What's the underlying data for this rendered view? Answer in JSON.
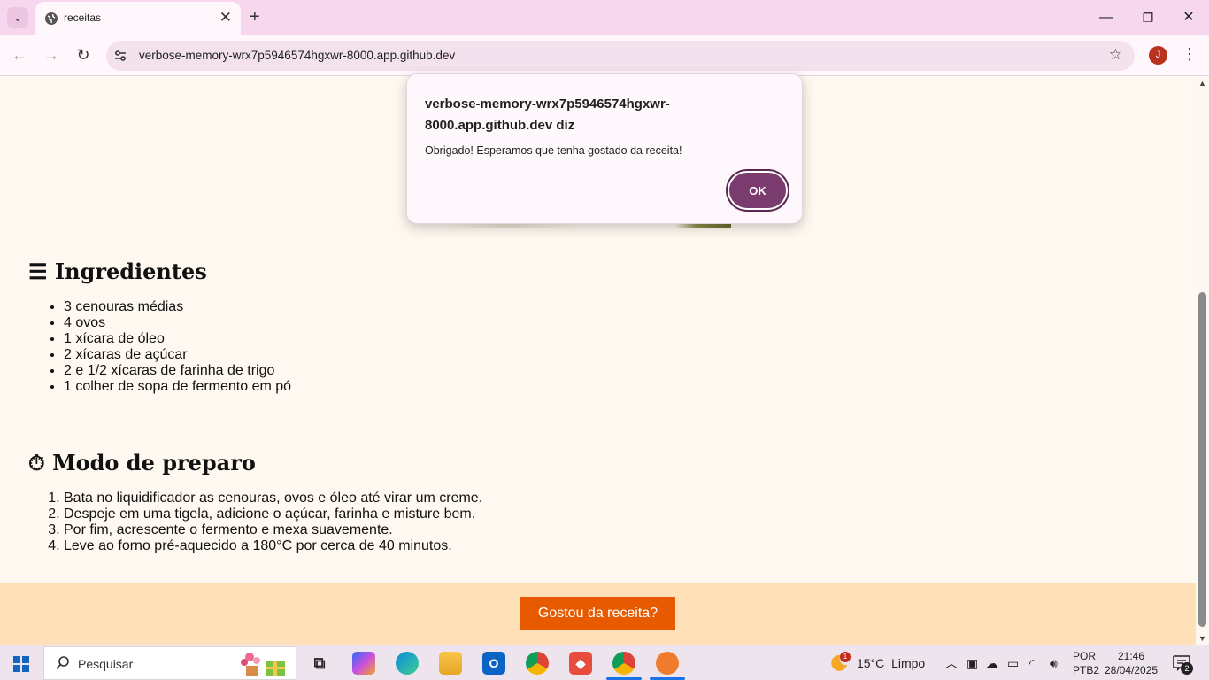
{
  "browser": {
    "tab_title": "receitas",
    "url": "verbose-memory-wrx7p5946574hgxwr-8000.app.github.dev",
    "profile_initial": "J"
  },
  "page": {
    "ingredients_heading": "☰ Ingredientes",
    "ingredients": [
      "3 cenouras médias",
      "4 ovos",
      "1 xícara de óleo",
      "2 xícaras de açúcar",
      "2 e 1/2 xícaras de farinha de trigo",
      "1 colher de sopa de fermento em pó"
    ],
    "method_heading": "⏱ Modo de preparo",
    "steps": [
      "Bata no liquidificador as cenouras, ovos e óleo até virar um creme.",
      "Despeje em uma tigela, adicione o açúcar, farinha e misture bem.",
      "Por fim, acrescente o fermento e mexa suavemente.",
      "Leve ao forno pré-aquecido a 180°C por cerca de 40 minutos."
    ],
    "cta_button": "Gostou da receita?"
  },
  "dialog": {
    "title": "verbose-memory-wrx7p5946574hgxwr-8000.app.github.dev diz",
    "message": "Obrigado! Esperamos que tenha gostado da receita!",
    "ok_label": "OK"
  },
  "taskbar": {
    "search_placeholder": "Pesquisar",
    "weather_temp": "15°C",
    "weather_desc": "Limpo",
    "weather_badge": "1",
    "lang_line1": "POR",
    "lang_line2": "PTB2",
    "time": "21:46",
    "date": "28/04/2025",
    "notification_count": "2"
  },
  "colors": {
    "page_bg": "#fff8f0",
    "footer_bg": "#ffe0b8",
    "cta_bg": "#e85a00",
    "dialog_ok_bg": "#7a3b6e",
    "tabbar_bg": "#f6d7ee"
  }
}
